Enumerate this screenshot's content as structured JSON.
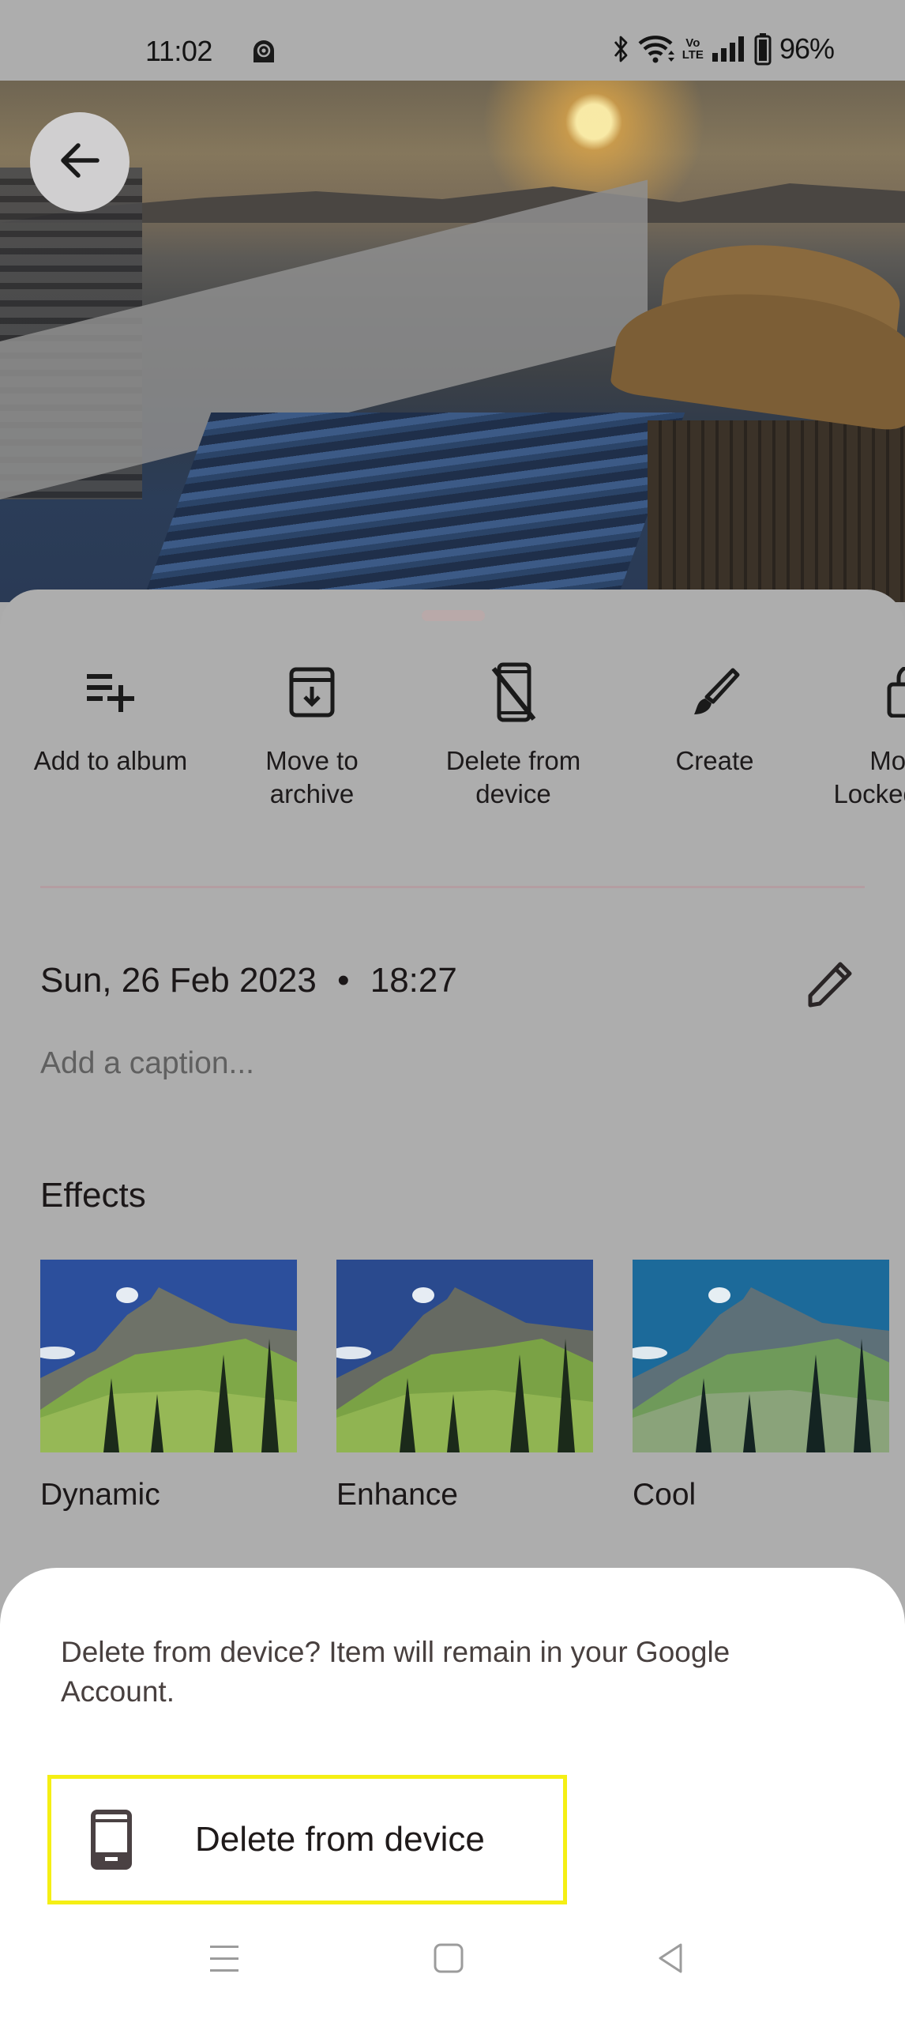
{
  "status_bar": {
    "time": "11:02",
    "notification_icon": "app-notification-icon",
    "icons": [
      "bluetooth-icon",
      "wifi-icon",
      "volte-icon",
      "signal-icon",
      "battery-icon"
    ],
    "volte_label_top": "Vo",
    "volte_label_bottom": "LTE",
    "battery_percent": "96%"
  },
  "photo_viewer": {
    "back_icon": "arrow-left-icon",
    "photo_description": "Rooftop pool at sunset over city skyline"
  },
  "info_sheet": {
    "actions": [
      {
        "label": "Add to album",
        "icon": "playlist-add-icon"
      },
      {
        "label": "Move to archive",
        "icon": "archive-icon"
      },
      {
        "label": "Delete from device",
        "icon": "mobile-off-icon"
      },
      {
        "label": "Create",
        "icon": "brush-icon"
      },
      {
        "label": "Move to Locked Folder",
        "icon": "lock-icon"
      }
    ],
    "date": "Sun, 26 Feb 2023",
    "separator": "•",
    "time": "18:27",
    "caption_placeholder": "Add a caption...",
    "effects_title": "Effects",
    "effects": [
      {
        "name": "Dynamic",
        "sky": "#2c4f9c"
      },
      {
        "name": "Enhance",
        "sky": "#2a4a8e"
      },
      {
        "name": "Cool",
        "sky": "#1c6a9a"
      }
    ]
  },
  "dialog": {
    "message": "Delete from device? Item will remain in your Google Account.",
    "option_label": "Delete from device",
    "option_icon": "smartphone-icon",
    "highlight_color": "#f5ef14"
  },
  "nav_bar": {
    "buttons": [
      "recents-icon",
      "home-icon",
      "back-icon"
    ]
  }
}
